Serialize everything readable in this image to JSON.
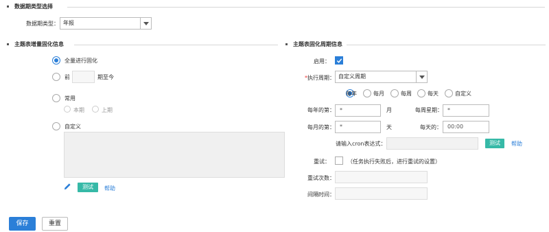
{
  "sections": {
    "data_type": "数据期类型选择",
    "incremental": "主题表增量固化信息",
    "cycle": "主题表固化周期信息"
  },
  "data_type": {
    "label": "数据期类型：",
    "value": "年报"
  },
  "incremental": {
    "option_full": "全量进行固化",
    "option_prev_prefix": "前",
    "option_prev_suffix": "期至今",
    "option_common": "常用",
    "sub_current": "本期",
    "sub_previous": "上期",
    "option_custom": "自定义",
    "test_label": "测试",
    "help_label": "帮助"
  },
  "cycle": {
    "enable_label": "启用：",
    "period_label": "执行周期：",
    "period_required_mark": "*",
    "period_value": "自定义周期",
    "freq_options": [
      "每年",
      "每月",
      "每周",
      "每天",
      "自定义"
    ],
    "year_day_label": "每年的第：",
    "year_day_value": "*",
    "month_unit": "月",
    "week_label": "每周星期：",
    "week_value": "*",
    "month_day_label": "每月的第：",
    "month_day_value": "*",
    "day_unit": "天",
    "day_time_label": "每天的：",
    "day_time_value": "00:00",
    "cron_label": "请输入cron表达式：",
    "test_label": "测试",
    "help_label": "帮助",
    "retry_label": "重试：",
    "retry_note": "（任务执行失败后，进行重试的设置）",
    "retry_count_label": "重试次数：",
    "interval_label": "间隔时间："
  },
  "buttons": {
    "save": "保存",
    "reset": "重置"
  },
  "colors": {
    "primary": "#2b7fd8",
    "test_button": "#36b9a7",
    "required": "#e33333"
  }
}
